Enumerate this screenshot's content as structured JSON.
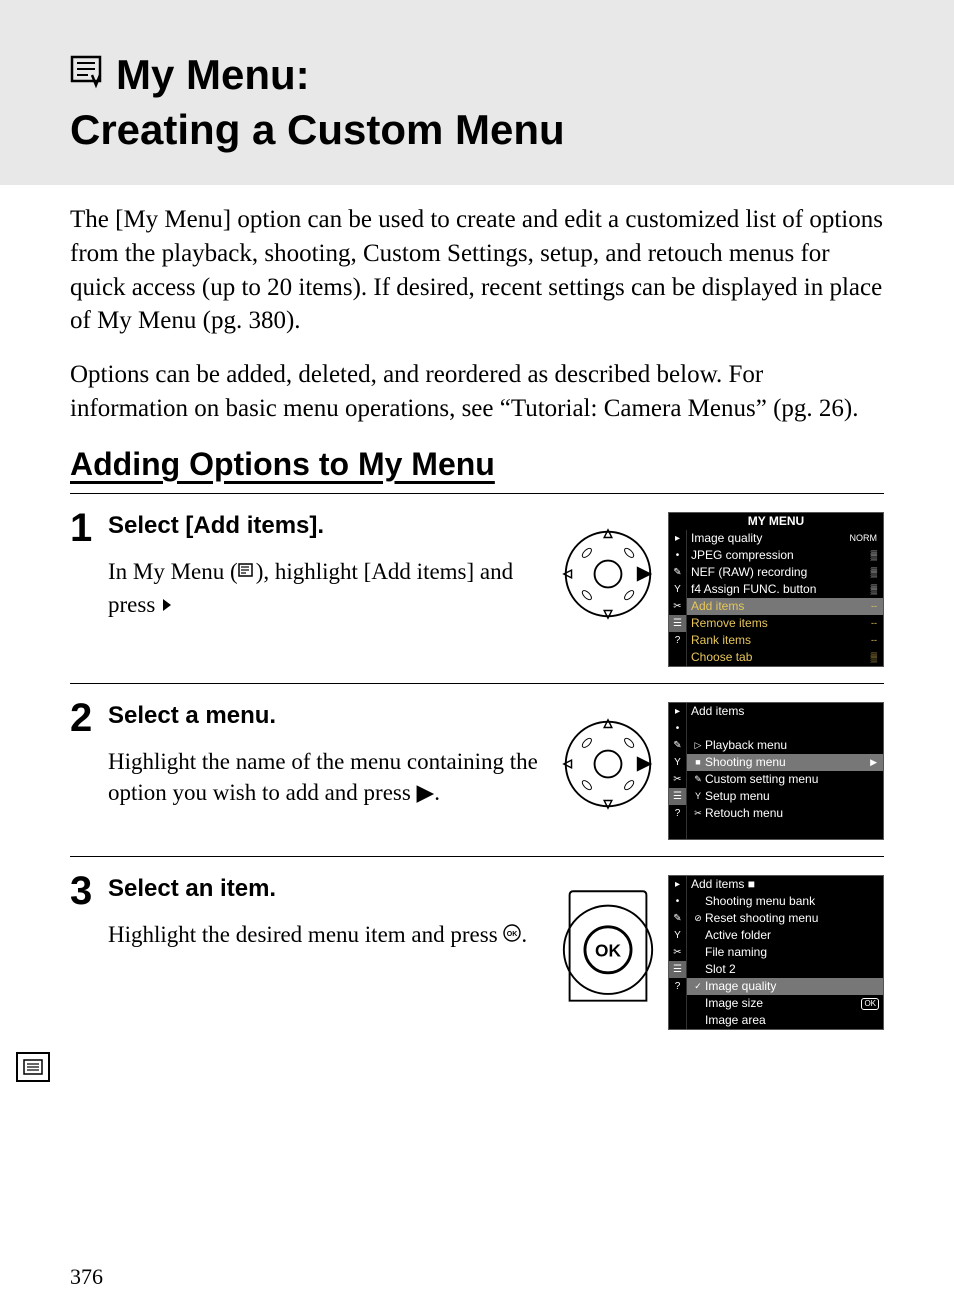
{
  "title_line1": "My Menu:",
  "title_line2": "Creating a Custom Menu",
  "intro_p1": "The [My Menu] option can be used to create and edit a customized list of options from the playback, shooting, Custom Settings, setup, and retouch menus for quick access (up to 20 items).  If desired, recent settings can be displayed in place of My Menu (pg. 380).",
  "intro_p2": "Options can be added, deleted, and reordered as described below. For information on basic menu operations, see “Tutorial: Camera Menus” (pg. 26).",
  "section_heading": "Adding Options to My Menu",
  "steps": [
    {
      "num": "1",
      "title": "Select [Add items].",
      "desc_a": "In My Menu (",
      "desc_b": "), highlight [Add items] and press ",
      "screen": {
        "header": "MY MENU",
        "rows": [
          {
            "label": "Image quality",
            "val": "NORM"
          },
          {
            "label": "JPEG compression",
            "val": "▒"
          },
          {
            "label": "NEF (RAW) recording",
            "val": "▒"
          },
          {
            "label": "f4 Assign FUNC. button",
            "val": "▒"
          },
          {
            "label": "Add items",
            "val": "--",
            "sel": true
          },
          {
            "label": "Remove items",
            "val": "--"
          },
          {
            "label": "Rank items",
            "val": "--"
          },
          {
            "label": "Choose tab",
            "val": "▒"
          }
        ]
      }
    },
    {
      "num": "2",
      "title": "Select a menu.",
      "desc": "Highlight the name of the menu containing the option you wish to add and press ▶.",
      "screen": {
        "header": "Add items",
        "rows": [
          {
            "icon": "▷",
            "label": "Playback menu"
          },
          {
            "icon": "■",
            "label": "Shooting menu",
            "sel": true,
            "arrow": true
          },
          {
            "icon": "✎",
            "label": "Custom setting menu"
          },
          {
            "icon": "Y",
            "label": "Setup menu"
          },
          {
            "icon": "✂",
            "label": "Retouch menu"
          }
        ]
      }
    },
    {
      "num": "3",
      "title": "Select an item.",
      "desc": "Highlight the desired menu item and press Ⓞ.",
      "screen": {
        "header": "Add items ■",
        "rows": [
          {
            "label": "Shooting menu bank"
          },
          {
            "label": "Reset shooting menu",
            "icon": "⊘"
          },
          {
            "label": "Active folder"
          },
          {
            "label": "File naming"
          },
          {
            "label": "Slot 2"
          },
          {
            "label": "Image quality",
            "sel": true,
            "icon": "✓"
          },
          {
            "label": "Image size",
            "ok": true
          },
          {
            "label": "Image area"
          }
        ]
      }
    }
  ],
  "page_number": "376"
}
